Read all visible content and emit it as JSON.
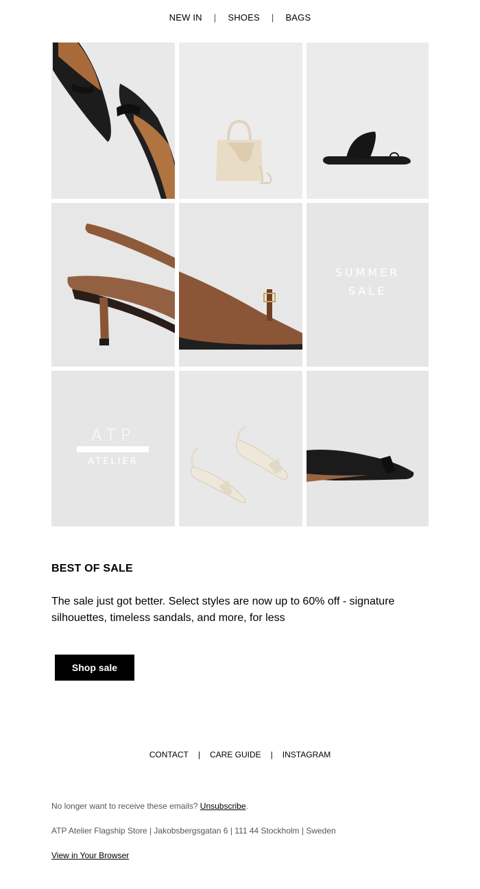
{
  "top_nav": {
    "items": [
      "NEW IN",
      "SHOES",
      "BAGS"
    ],
    "separator": "|"
  },
  "grid": {
    "sale_line1": "SUMMER",
    "sale_line2": "SALE",
    "brand_name": "ATP",
    "brand_sub": "ATELIER"
  },
  "promo": {
    "headline": "BEST OF SALE",
    "body": "The sale just got better. Select styles are now up to 60% off - signature silhouettes, timeless sandals, and more, for less",
    "cta_label": "Shop sale"
  },
  "footer_nav": {
    "items": [
      "CONTACT",
      "CARE GUIDE",
      "INSTAGRAM"
    ],
    "separator": "|"
  },
  "footer": {
    "unsubscribe_prefix": "No longer want to receive these emails?",
    "unsubscribe_link": "Unsubscribe",
    "unsubscribe_suffix": ".",
    "address": "ATP Atelier Flagship Store | Jakobsbergsgatan 6 | 111 44 Stockholm | Sweden",
    "view_in_browser": "View in Your Browser"
  }
}
